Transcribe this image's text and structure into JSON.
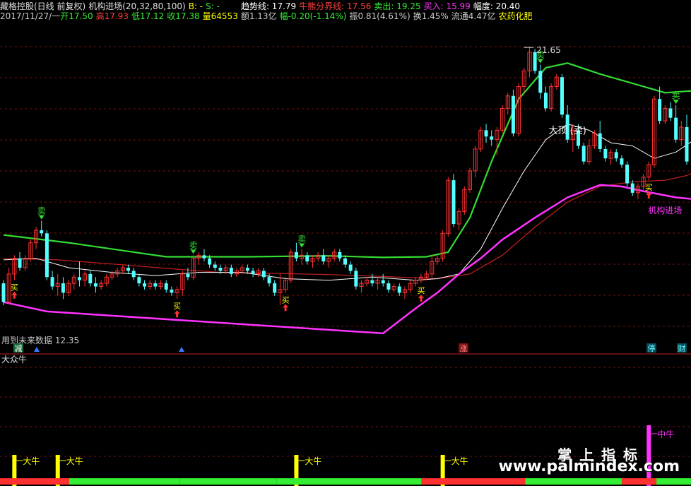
{
  "header": {
    "stock": "藏格控股(日线 前复权)",
    "indicator": "机构进场(20,32,80,100)",
    "b_label": "B: -",
    "s_label": "S: -",
    "trend_label": "趋势线: 17.79",
    "bull_bear_label": "牛熊分界线: 17.56",
    "sell_label": "卖出: 19.25",
    "buy_label": "买入: 15.99",
    "amplitude_label": "幅度: 20.40",
    "date": "2017/11/27/一",
    "open": "开17.50",
    "high": "高17.93",
    "low": "低17.12",
    "close": "收17.38",
    "volume": "量64553",
    "amount": "额1.13亿",
    "change": "幅-0.20(-1.14%)",
    "swing": "振0.81(4.61%)",
    "turnover": "换1.45%",
    "float": "流通4.47亿",
    "sector": "农药化肥"
  },
  "colors": {
    "up": "#ff3232",
    "down": "#54ffff",
    "green_line": "#33dd33",
    "magenta": "#ff33ff",
    "white_ma": "#ffffff",
    "red_ma": "#c42020",
    "yellow": "#ffff00",
    "grid": "#7a1010"
  },
  "annotations": {
    "peak_value": "21.65",
    "low_note": "用到未来数据 12.35",
    "top_label": "大顶 (卖)",
    "institution_label": "机构进场",
    "sell_glyph": "卖",
    "buy_glyph": "买",
    "badge_decrease": "减",
    "badge_rise": "涨",
    "badge_stop": "停",
    "badge_finance": "财"
  },
  "sub_panel": {
    "title": "大众牛",
    "big_bull": "大牛",
    "mid_bull": "中牛"
  },
  "watermark": {
    "line1": "掌 上 指 标",
    "line2": "www.palmindex.com"
  },
  "chart_data": {
    "type": "candlestick",
    "ylim": [
      12.0,
      22.4
    ],
    "candles": [
      [
        14.1,
        14.2,
        13.4,
        13.5
      ],
      [
        13.5,
        14.6,
        13.45,
        14.4
      ],
      [
        14.4,
        15.0,
        14.2,
        14.9
      ],
      [
        14.9,
        15.1,
        14.5,
        14.6
      ],
      [
        14.6,
        15.0,
        14.5,
        14.9
      ],
      [
        14.9,
        15.5,
        14.8,
        15.4
      ],
      [
        15.4,
        15.9,
        15.2,
        15.8
      ],
      [
        15.8,
        16.1,
        15.6,
        15.7
      ],
      [
        15.7,
        15.8,
        14.2,
        14.3
      ],
      [
        14.3,
        14.5,
        13.9,
        14.0
      ],
      [
        14.0,
        14.4,
        13.7,
        14.1
      ],
      [
        14.1,
        14.3,
        13.6,
        13.8
      ],
      [
        13.8,
        14.2,
        13.7,
        14.1
      ],
      [
        14.1,
        14.4,
        13.9,
        14.3
      ],
      [
        14.3,
        14.8,
        14.0,
        14.2
      ],
      [
        14.2,
        14.5,
        14.0,
        14.4
      ],
      [
        14.4,
        14.5,
        14.0,
        14.1
      ],
      [
        14.1,
        14.3,
        13.8,
        14.0
      ],
      [
        14.0,
        14.2,
        13.9,
        14.1
      ],
      [
        14.1,
        14.4,
        14.0,
        14.3
      ],
      [
        14.3,
        14.5,
        14.2,
        14.4
      ],
      [
        14.4,
        14.6,
        14.3,
        14.5
      ],
      [
        14.5,
        14.7,
        14.4,
        14.6
      ],
      [
        14.6,
        14.7,
        14.4,
        14.5
      ],
      [
        14.5,
        14.6,
        14.2,
        14.3
      ],
      [
        14.3,
        14.4,
        14.0,
        14.1
      ],
      [
        14.1,
        14.2,
        13.9,
        14.0
      ],
      [
        14.0,
        14.2,
        13.9,
        14.1
      ],
      [
        14.1,
        14.2,
        13.9,
        14.0
      ],
      [
        14.0,
        14.2,
        13.9,
        14.1
      ],
      [
        14.1,
        14.2,
        13.8,
        13.9
      ],
      [
        13.9,
        14.0,
        13.7,
        13.8
      ],
      [
        13.8,
        14.0,
        13.6,
        13.9
      ],
      [
        13.9,
        14.5,
        13.7,
        14.4
      ],
      [
        14.4,
        14.6,
        14.2,
        14.3
      ],
      [
        14.3,
        15.0,
        14.2,
        14.9
      ],
      [
        14.9,
        15.1,
        14.7,
        15.0
      ],
      [
        15.0,
        15.2,
        14.8,
        14.9
      ],
      [
        14.9,
        15.0,
        14.6,
        14.7
      ],
      [
        14.7,
        14.8,
        14.5,
        14.6
      ],
      [
        14.6,
        14.7,
        14.4,
        14.5
      ],
      [
        14.5,
        14.7,
        14.4,
        14.6
      ],
      [
        14.6,
        14.7,
        14.3,
        14.4
      ],
      [
        14.4,
        14.6,
        14.3,
        14.5
      ],
      [
        14.5,
        14.7,
        14.4,
        14.6
      ],
      [
        14.6,
        14.7,
        14.4,
        14.5
      ],
      [
        14.5,
        14.6,
        14.3,
        14.4
      ],
      [
        14.4,
        14.6,
        14.3,
        14.5
      ],
      [
        14.5,
        14.6,
        14.2,
        14.3
      ],
      [
        14.3,
        14.4,
        14.0,
        14.1
      ],
      [
        14.1,
        14.2,
        13.7,
        13.8
      ],
      [
        13.8,
        14.4,
        13.4,
        13.9
      ],
      [
        13.9,
        14.3,
        13.8,
        14.2
      ],
      [
        14.2,
        15.2,
        14.1,
        15.1
      ],
      [
        15.1,
        15.4,
        14.8,
        14.9
      ],
      [
        14.9,
        15.2,
        14.7,
        15.0
      ],
      [
        15.0,
        15.1,
        14.7,
        14.8
      ],
      [
        14.8,
        15.0,
        14.6,
        14.9
      ],
      [
        14.9,
        15.1,
        14.8,
        15.0
      ],
      [
        15.0,
        15.2,
        14.7,
        14.8
      ],
      [
        14.8,
        15.0,
        14.6,
        14.9
      ],
      [
        14.9,
        15.2,
        14.8,
        15.1
      ],
      [
        15.1,
        15.2,
        14.8,
        14.9
      ],
      [
        14.9,
        15.0,
        14.6,
        14.7
      ],
      [
        14.7,
        14.8,
        14.4,
        14.5
      ],
      [
        14.5,
        14.6,
        13.9,
        14.0
      ],
      [
        14.0,
        14.2,
        13.8,
        14.1
      ],
      [
        14.1,
        14.3,
        14.0,
        14.2
      ],
      [
        14.2,
        14.4,
        14.0,
        14.1
      ],
      [
        14.1,
        14.3,
        13.9,
        14.2
      ],
      [
        14.2,
        14.4,
        14.0,
        14.1
      ],
      [
        14.1,
        14.2,
        13.8,
        13.9
      ],
      [
        13.9,
        14.1,
        13.8,
        14.0
      ],
      [
        14.0,
        14.1,
        13.7,
        13.8
      ],
      [
        13.8,
        14.0,
        13.6,
        13.9
      ],
      [
        13.9,
        14.2,
        13.8,
        14.1
      ],
      [
        14.1,
        14.3,
        14.0,
        14.2
      ],
      [
        14.2,
        14.4,
        14.1,
        14.3
      ],
      [
        14.3,
        14.5,
        14.2,
        14.4
      ],
      [
        14.4,
        15.0,
        14.3,
        14.8
      ],
      [
        14.8,
        15.0,
        14.7,
        14.9
      ],
      [
        14.9,
        15.8,
        14.8,
        15.7
      ],
      [
        15.7,
        17.5,
        15.6,
        17.4
      ],
      [
        17.4,
        17.6,
        15.9,
        16.0
      ],
      [
        16.0,
        16.5,
        15.8,
        16.4
      ],
      [
        16.4,
        17.2,
        16.3,
        17.1
      ],
      [
        17.1,
        17.8,
        17.0,
        17.7
      ],
      [
        17.7,
        18.5,
        17.5,
        18.4
      ],
      [
        18.4,
        19.1,
        18.3,
        19.0
      ],
      [
        19.0,
        19.2,
        18.6,
        18.8
      ],
      [
        18.8,
        19.0,
        18.5,
        18.7
      ],
      [
        18.7,
        19.1,
        18.2,
        19.0
      ],
      [
        19.0,
        19.8,
        18.9,
        19.7
      ],
      [
        19.7,
        20.2,
        19.5,
        20.1
      ],
      [
        20.1,
        20.3,
        18.8,
        18.9
      ],
      [
        18.9,
        20.5,
        18.8,
        20.4
      ],
      [
        20.4,
        21.0,
        20.2,
        20.9
      ],
      [
        20.9,
        21.65,
        20.7,
        21.5
      ],
      [
        21.5,
        21.6,
        20.8,
        20.9
      ],
      [
        20.9,
        21.1,
        20.0,
        20.2
      ],
      [
        20.2,
        20.4,
        19.6,
        19.7
      ],
      [
        19.7,
        20.5,
        19.6,
        20.4
      ],
      [
        20.4,
        20.8,
        20.3,
        20.7
      ],
      [
        20.7,
        20.8,
        19.4,
        19.5
      ],
      [
        19.5,
        19.8,
        18.6,
        18.7
      ],
      [
        18.7,
        19.2,
        18.3,
        19.0
      ],
      [
        19.0,
        19.2,
        18.4,
        18.5
      ],
      [
        18.5,
        18.6,
        17.9,
        18.0
      ],
      [
        18.0,
        18.7,
        17.9,
        18.5
      ],
      [
        18.5,
        19.0,
        18.4,
        18.9
      ],
      [
        18.9,
        19.3,
        18.3,
        18.4
      ],
      [
        18.4,
        18.5,
        18.0,
        18.1
      ],
      [
        18.1,
        18.4,
        17.9,
        18.3
      ],
      [
        18.3,
        18.4,
        18.0,
        18.1
      ],
      [
        18.1,
        18.2,
        17.8,
        17.9
      ],
      [
        17.9,
        18.0,
        17.2,
        17.3
      ],
      [
        17.3,
        17.4,
        16.9,
        17.0
      ],
      [
        17.0,
        17.3,
        16.8,
        17.2
      ],
      [
        17.2,
        17.6,
        17.1,
        17.5
      ],
      [
        17.5,
        18.0,
        17.4,
        17.9
      ],
      [
        17.9,
        20.1,
        17.8,
        20.0
      ],
      [
        20.0,
        20.4,
        19.2,
        19.3
      ],
      [
        19.3,
        19.8,
        19.2,
        19.7
      ],
      [
        19.7,
        19.9,
        19.3,
        19.4
      ],
      [
        19.4,
        19.8,
        18.6,
        18.7
      ],
      [
        18.7,
        19.3,
        18.5,
        19.1
      ],
      [
        19.1,
        19.5,
        17.9,
        18.0
      ]
    ],
    "green_band": [
      [
        0,
        15.65
      ],
      [
        12,
        15.4
      ],
      [
        22,
        15.15
      ],
      [
        30,
        14.95
      ],
      [
        45,
        14.95
      ],
      [
        60,
        14.98
      ],
      [
        70,
        14.93
      ],
      [
        78,
        14.95
      ],
      [
        82,
        15.1
      ],
      [
        86,
        16.2
      ],
      [
        90,
        18.0
      ],
      [
        95,
        20.0
      ],
      [
        100,
        21.0
      ],
      [
        104,
        21.15
      ],
      [
        110,
        20.8
      ],
      [
        116,
        20.5
      ],
      [
        122,
        20.2
      ],
      [
        130,
        20.3
      ]
    ],
    "white_ma": [
      [
        0,
        14.85
      ],
      [
        6,
        14.9
      ],
      [
        12,
        14.6
      ],
      [
        20,
        14.45
      ],
      [
        28,
        14.35
      ],
      [
        36,
        14.45
      ],
      [
        44,
        14.45
      ],
      [
        52,
        14.25
      ],
      [
        60,
        14.2
      ],
      [
        68,
        14.3
      ],
      [
        76,
        14.2
      ],
      [
        80,
        14.25
      ],
      [
        84,
        14.4
      ],
      [
        88,
        15.2
      ],
      [
        92,
        16.5
      ],
      [
        96,
        17.7
      ],
      [
        100,
        18.7
      ],
      [
        104,
        19.2
      ],
      [
        108,
        19.0
      ],
      [
        112,
        18.6
      ],
      [
        116,
        18.5
      ],
      [
        120,
        18.1
      ],
      [
        124,
        18.3
      ],
      [
        130,
        19.0
      ]
    ],
    "red_ma": [
      [
        0,
        14.9
      ],
      [
        10,
        14.85
      ],
      [
        20,
        14.72
      ],
      [
        30,
        14.58
      ],
      [
        40,
        14.45
      ],
      [
        50,
        14.42
      ],
      [
        60,
        14.38
      ],
      [
        70,
        14.32
      ],
      [
        80,
        14.25
      ],
      [
        86,
        14.4
      ],
      [
        92,
        15.0
      ],
      [
        98,
        15.9
      ],
      [
        104,
        16.7
      ],
      [
        110,
        17.2
      ],
      [
        116,
        17.35
      ],
      [
        122,
        17.4
      ],
      [
        126,
        17.55
      ],
      [
        130,
        17.85
      ]
    ],
    "magenta_line": [
      [
        0,
        13.5
      ],
      [
        8,
        13.2
      ],
      [
        70,
        12.5
      ],
      [
        76,
        13.3
      ],
      [
        80,
        13.8
      ],
      [
        84,
        14.4
      ],
      [
        88,
        14.9
      ],
      [
        92,
        15.5
      ],
      [
        98,
        16.2
      ],
      [
        104,
        16.85
      ],
      [
        110,
        17.25
      ],
      [
        114,
        17.2
      ],
      [
        118,
        17.05
      ],
      [
        124,
        16.85
      ],
      [
        130,
        16.75
      ]
    ],
    "sell_marks": [
      7,
      35,
      55,
      99,
      124
    ],
    "buy_marks": [
      2,
      32,
      52,
      77,
      119
    ],
    "sub_bull_marks": [
      2,
      10,
      54,
      81
    ],
    "sub_mid_mark": 119,
    "bottom_strip": [
      [
        "#ff3030",
        0,
        0.1
      ],
      [
        "#33ee33",
        0.1,
        0.26
      ],
      [
        "#33ee33",
        0.26,
        0.4
      ],
      [
        "#33ee33",
        0.4,
        0.61
      ],
      [
        "#ff3030",
        0.61,
        0.76
      ],
      [
        "#33ee33",
        0.76,
        0.9
      ],
      [
        "#ff3030",
        0.9,
        0.95
      ],
      [
        "#33ee33",
        0.95,
        1.0
      ]
    ]
  }
}
